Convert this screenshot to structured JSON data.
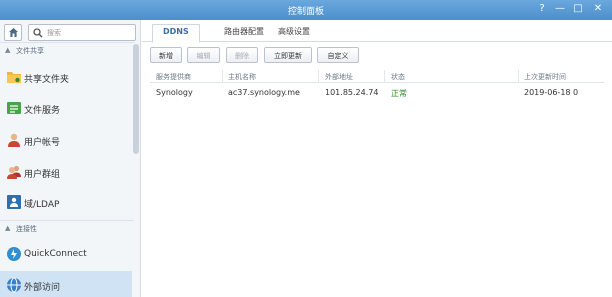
{
  "window": {
    "title": "控制面板",
    "help_label": "?",
    "minimize_label": "—",
    "maximize_label": "□",
    "close_label": "✕"
  },
  "sidebar": {
    "search_placeholder": "搜索",
    "sections": [
      {
        "label": "文件共享"
      },
      {
        "label": "连接性"
      }
    ],
    "items": [
      {
        "label": "共享文件夹",
        "icon": "shared-folder-icon"
      },
      {
        "label": "文件服务",
        "icon": "file-services-icon"
      },
      {
        "label": "用户帐号",
        "icon": "user-icon"
      },
      {
        "label": "用户群组",
        "icon": "group-icon"
      },
      {
        "label": "域/LDAP",
        "icon": "domain-ldap-icon"
      },
      {
        "label": "QuickConnect",
        "icon": "quickconnect-icon"
      },
      {
        "label": "外部访问",
        "icon": "external-access-icon"
      }
    ]
  },
  "main": {
    "tabs": [
      {
        "label": "DDNS"
      },
      {
        "label": "路由器配置"
      },
      {
        "label": "高级设置"
      }
    ],
    "toolbar": {
      "add": "新增",
      "edit": "编辑",
      "delete": "删除",
      "update_now": "立即更新",
      "customize": "自定义"
    },
    "grid": {
      "columns": [
        "服务提供商",
        "主机名称",
        "外部地址",
        "状态",
        "上次更新时间"
      ],
      "rows": [
        [
          "Synology",
          "ac37.synology.me",
          "101.85.24.74",
          "正常",
          "2019-06-18 0"
        ]
      ]
    }
  },
  "colors": {
    "titlebar": "#5a9ad4",
    "accent": "#3a6e9f",
    "status_ok": "#2f8a2f",
    "active_item": "#cfe3f5"
  }
}
